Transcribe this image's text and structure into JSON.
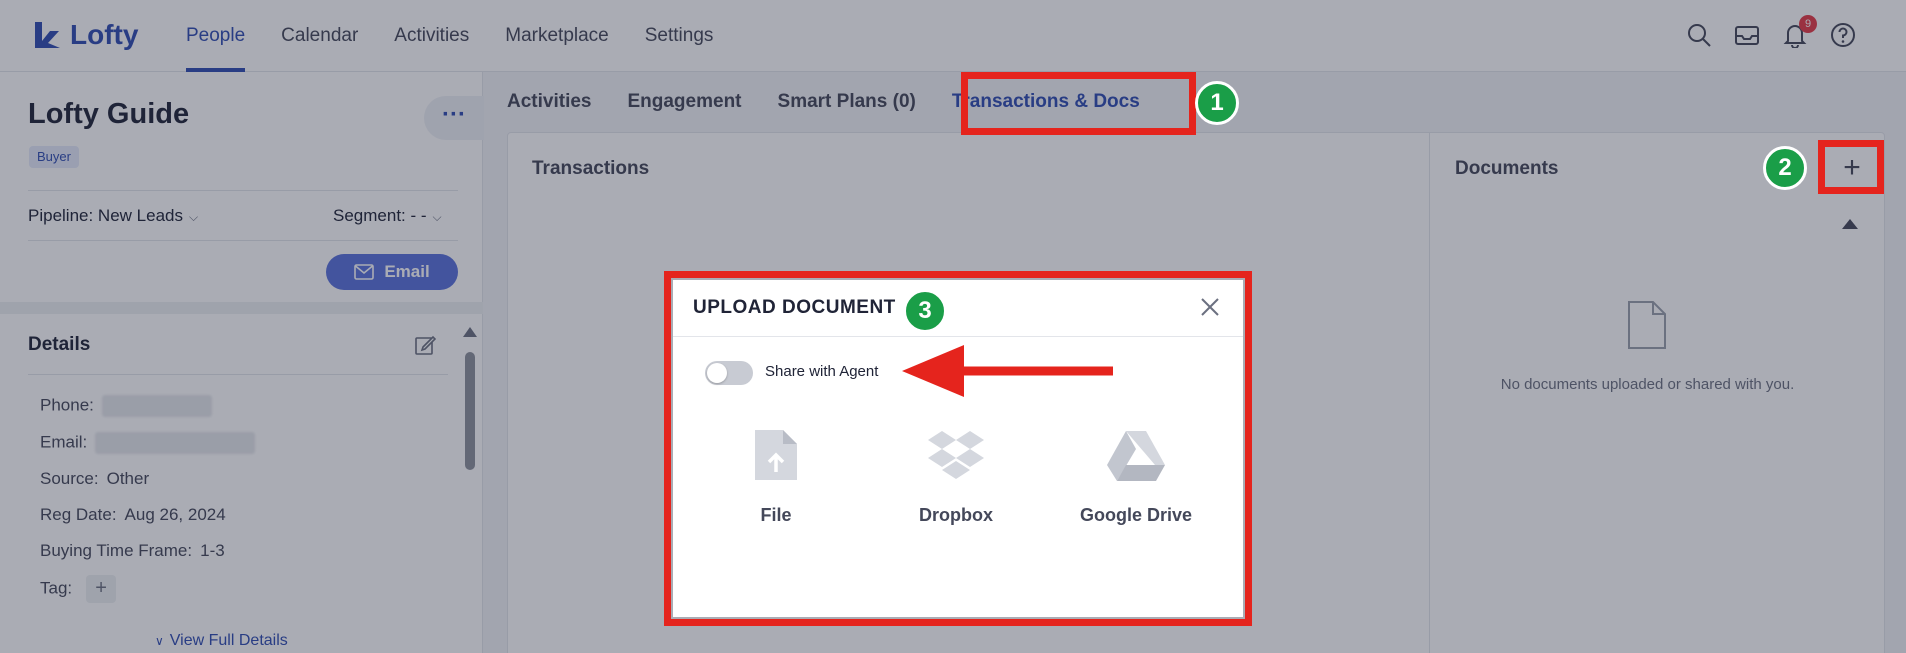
{
  "app": {
    "logo_text": "Lofty",
    "nav": [
      "People",
      "Calendar",
      "Activities",
      "Marketplace",
      "Settings"
    ],
    "active_nav": "People",
    "notification_count": "9",
    "brand_color": "#2f4db2"
  },
  "contact": {
    "name": "Lofty Guide",
    "role_tag": "Buyer",
    "more_label": "···",
    "pipeline_label": "Pipeline: New Leads",
    "segment_label": "Segment: - -",
    "email_button": "Email"
  },
  "details": {
    "title": "Details",
    "phone_label": "Phone:",
    "email_label": "Email:",
    "source_label": "Source:",
    "source_value": "Other",
    "reg_date_label": "Reg Date:",
    "reg_date_value": "Aug 26, 2024",
    "buying_time_label": "Buying Time Frame:",
    "buying_time_value": "1-3",
    "tag_label": "Tag:",
    "tag_add": "+",
    "view_full": "View Full Details"
  },
  "tabs": [
    "Activities",
    "Engagement",
    "Smart Plans (0)",
    "Transactions & Docs"
  ],
  "active_tab": "Transactions & Docs",
  "transactions": {
    "title": "Transactions"
  },
  "documents": {
    "title": "Documents",
    "add_label": "+",
    "empty_text": "No documents uploaded or shared with you."
  },
  "modal": {
    "title": "UPLOAD DOCUMENT",
    "share_label": "Share with Agent",
    "share_enabled": false,
    "sources": [
      {
        "label": "File",
        "icon": "file-upload-icon"
      },
      {
        "label": "Dropbox",
        "icon": "dropbox-icon"
      },
      {
        "label": "Google Drive",
        "icon": "google-drive-icon"
      }
    ]
  },
  "annotations": {
    "steps": [
      "1",
      "2",
      "3"
    ],
    "highlight_color": "#e5241d",
    "step_color": "#1a9e48"
  }
}
